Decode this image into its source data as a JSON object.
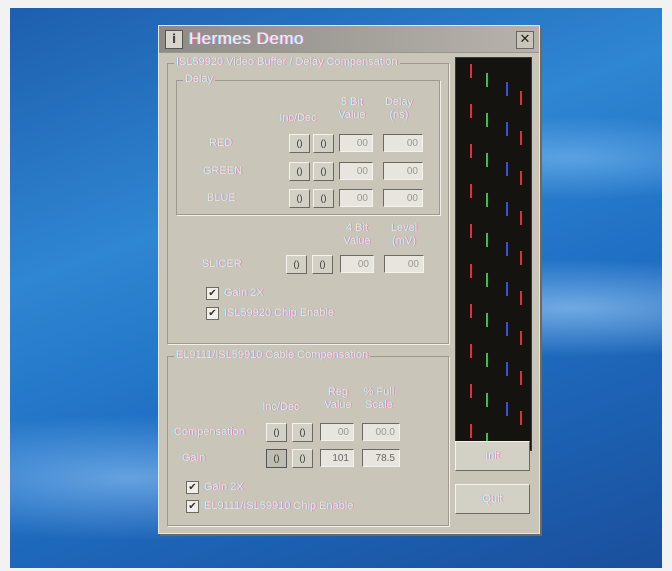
{
  "window": {
    "title": "Hermes Demo",
    "app_icon_glyph": "i",
    "close_glyph": "✕"
  },
  "video_group": {
    "label": "ISL59920 Video Buffer / Delay Compensation",
    "delay_group": {
      "label": "Delay",
      "col_incdec": "Inc/Dec",
      "col_value_1": "5 Bit",
      "col_value_2": "Value",
      "col_delay_1": "Delay",
      "col_delay_2": "(ns)",
      "rows": [
        {
          "label": "RED",
          "inc": "()",
          "dec": "()",
          "value": "00",
          "delay": "00"
        },
        {
          "label": "GREEN",
          "inc": "()",
          "dec": "()",
          "value": "00",
          "delay": "00"
        },
        {
          "label": "BLUE",
          "inc": "()",
          "dec": "()",
          "value": "00",
          "delay": "00"
        }
      ]
    },
    "slicer": {
      "col_value_1": "4 Bit",
      "col_value_2": "Value",
      "col_level_1": "Level",
      "col_level_2": "(mV)",
      "label": "SLICER",
      "inc": "()",
      "dec": "()",
      "value": "00",
      "level": "00"
    },
    "gain2x_label": "Gain 2X",
    "gain2x_checked": true,
    "chip_enable_label": "ISL59920 Chip Enable",
    "chip_enable_checked": true
  },
  "cable_group": {
    "label": "EL9111/ISL59910 Cable Compensation",
    "col_incdec": "Inc/Dec",
    "col_reg_1": "Reg",
    "col_reg_2": "Value",
    "col_pct_1": "% Full",
    "col_pct_2": "Scale",
    "compensation": {
      "label": "Compensation",
      "inc": "()",
      "dec": "()",
      "value": "00",
      "pct": "00.0"
    },
    "gain": {
      "label": "Gain",
      "inc": "()",
      "dec": "()",
      "value": "101",
      "pct": "78.5"
    },
    "gain2x_label": "Gain 2X",
    "gain2x_checked": true,
    "chip_enable_label": "EL9111/ISL59910 Chip Enable",
    "chip_enable_checked": true
  },
  "buttons": {
    "init": "Init",
    "quit": "Quit"
  },
  "preview": {
    "line_colors": [
      "#e0303a",
      "#34c04a",
      "#3a54d8",
      "#e0303a"
    ]
  },
  "check_glyph": "✔"
}
